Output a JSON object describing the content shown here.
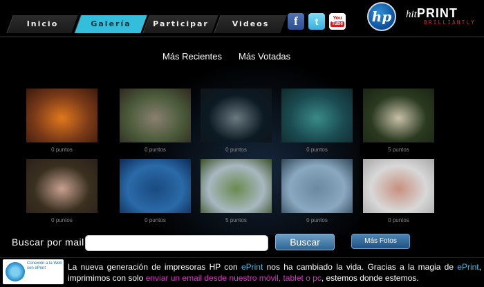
{
  "nav": {
    "items": [
      {
        "label": "Inicio"
      },
      {
        "label": "Galería"
      },
      {
        "label": "Participar"
      },
      {
        "label": "Videos"
      }
    ],
    "active_index": 1
  },
  "social": {
    "facebook": "f",
    "twitter": "t",
    "youtube_top": "You",
    "youtube_bottom": "Tube"
  },
  "brand": {
    "hp_logo": "hp",
    "hit": "hit",
    "print": "PRINT",
    "tagline": "BRILLIANTLY"
  },
  "gallery": {
    "tabs": [
      "Más Recientes",
      "Más Votadas"
    ],
    "photos": [
      {
        "points": "0 puntos",
        "desc": "orange plush",
        "colors": [
          "#7a3a18",
          "#e0781c",
          "#3b1a0c"
        ]
      },
      {
        "points": "0 puntos",
        "desc": "children outdoors",
        "colors": [
          "#4a5a3a",
          "#8a8070",
          "#302820"
        ]
      },
      {
        "points": "0 puntos",
        "desc": "group night",
        "colors": [
          "#0c1a24",
          "#6a7a80",
          "#101418"
        ]
      },
      {
        "points": "0 puntos",
        "desc": "scuba diver",
        "colors": [
          "#1a4a50",
          "#3a8a88",
          "#102a2c"
        ]
      },
      {
        "points": "5 puntos",
        "desc": "sheep on grass",
        "colors": [
          "#2a3a20",
          "#c8c0a8",
          "#1a2414"
        ]
      },
      {
        "points": "0 puntos",
        "desc": "toddler girl",
        "colors": [
          "#3a3020",
          "#c8a090",
          "#2a2018"
        ]
      },
      {
        "points": "0 puntos",
        "desc": "blue mountains",
        "colors": [
          "#2a6aa8",
          "#1a4a80",
          "#0c2a58"
        ]
      },
      {
        "points": "5 puntos",
        "desc": "green landscape",
        "colors": [
          "#a8b8c0",
          "#6a8a50",
          "#3a5028"
        ]
      },
      {
        "points": "0 puntos",
        "desc": "harbor ship",
        "colors": [
          "#8aa8c0",
          "#6a8aa0",
          "#304858"
        ]
      },
      {
        "points": "0 puntos",
        "desc": "baby sitting",
        "colors": [
          "#d8d8d8",
          "#c89080",
          "#a8a8a8"
        ]
      }
    ]
  },
  "search": {
    "label": "Buscar por mail:",
    "placeholder": "",
    "button": "Buscar",
    "more_button": "Más Fotos"
  },
  "footer": {
    "badge_text": "Conexión a la Web con ePrint",
    "t1": "La nueva generación de impresoras HP con ",
    "h1": "ePrint",
    "t2": " nos ha cambiado la vida. Gracias a la magia de ",
    "h2": "ePrint",
    "t3": ", imprimimos con solo ",
    "h3": "enviar un email desde nuestro móvil, tablet o pc",
    "t4": ", estemos donde estemos."
  }
}
